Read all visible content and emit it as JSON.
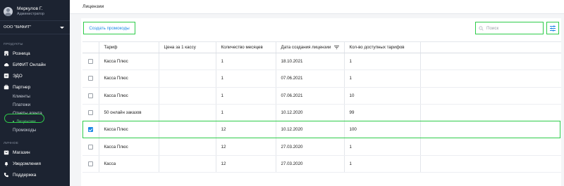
{
  "user": {
    "name": "Меркулов Г.",
    "role": "Администратор"
  },
  "org": {
    "name": "ООО \"БИФИТ\""
  },
  "sidebar": {
    "section_products": "ПРОДУКТЫ",
    "products": [
      {
        "label": "Розница",
        "icon": "store-icon"
      },
      {
        "label": "БИФИТ Онлайн",
        "icon": "cloud-icon"
      },
      {
        "label": "ЭДО",
        "icon": "document-exchange-icon"
      },
      {
        "label": "Партнер",
        "icon": "briefcase-icon"
      }
    ],
    "partner_sub": [
      {
        "label": "Клиенты"
      },
      {
        "label": "Платежи"
      },
      {
        "label": "Отчеты агента"
      },
      {
        "label": "Лицензии",
        "active": true
      },
      {
        "label": "Промокоды"
      }
    ],
    "section_personal": "ЛИЧНОЕ",
    "personal": [
      {
        "label": "Магазин",
        "icon": "shop-icon"
      },
      {
        "label": "Уведомления",
        "icon": "bell-icon"
      },
      {
        "label": "Поддержка",
        "icon": "phone-icon"
      }
    ]
  },
  "header": {
    "title": "Лицензии"
  },
  "toolbar": {
    "create_label": "Создать промокоды",
    "search_placeholder": "Поиск",
    "search_value": ""
  },
  "table": {
    "columns": [
      "Тариф",
      "Цена за 1 кассу",
      "Количество месяцев",
      "Дата создания лицензии",
      "Кол-во доступных тарифов"
    ],
    "rows": [
      {
        "checked": false,
        "tariff": "Касса Плюс",
        "price": "",
        "months": "1",
        "date": "18.10.2021",
        "count": "1"
      },
      {
        "checked": false,
        "tariff": "Касса Плюс",
        "price": "",
        "months": "1",
        "date": "07.06.2021",
        "count": "1"
      },
      {
        "checked": false,
        "tariff": "Касса Плюс",
        "price": "",
        "months": "1",
        "date": "07.06.2021",
        "count": "10"
      },
      {
        "checked": false,
        "tariff": "50 онлайн заказов",
        "price": "",
        "months": "1",
        "date": "10.12.2020",
        "count": "99"
      },
      {
        "checked": true,
        "tariff": "Касса Плюс",
        "price": "",
        "months": "12",
        "date": "10.12.2020",
        "count": "100"
      },
      {
        "checked": false,
        "tariff": "Касса Плюс",
        "price": "",
        "months": "12",
        "date": "27.03.2020",
        "count": "1"
      },
      {
        "checked": false,
        "tariff": "Касса",
        "price": "",
        "months": "12",
        "date": "27.03.2020",
        "count": "1"
      }
    ]
  },
  "colors": {
    "accent": "#1e88e5",
    "sidebar_bg": "#1c2331",
    "highlight": "#2ecc4a",
    "active_nav": "#5ad07a"
  }
}
